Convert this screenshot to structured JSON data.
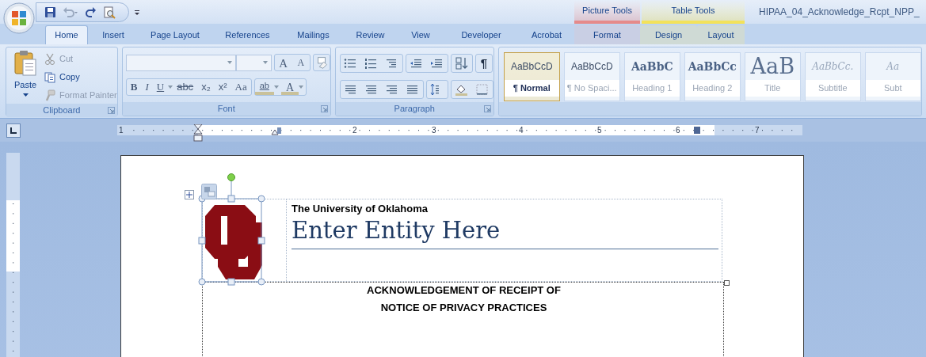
{
  "window": {
    "title": "HIPAA_04_Acknowledge_Rcpt_NPP_"
  },
  "contextual_groups": [
    {
      "label": "Picture Tools",
      "color": "#e58a8a"
    },
    {
      "label": "Table Tools",
      "color": "#f3e25a"
    }
  ],
  "tabs": [
    {
      "label": "Home",
      "selected": true
    },
    {
      "label": "Insert",
      "selected": false
    },
    {
      "label": "Page Layout",
      "selected": false
    },
    {
      "label": "References",
      "selected": false
    },
    {
      "label": "Mailings",
      "selected": false
    },
    {
      "label": "Review",
      "selected": false
    },
    {
      "label": "View",
      "selected": false
    },
    {
      "label": "Developer",
      "selected": false
    },
    {
      "label": "Acrobat",
      "selected": false
    },
    {
      "label": "Format",
      "selected": false
    },
    {
      "label": "Design",
      "selected": false
    },
    {
      "label": "Layout",
      "selected": false
    }
  ],
  "clipboard": {
    "label": "Clipboard",
    "paste": "Paste",
    "commands": [
      {
        "label": "Cut",
        "disabled": true
      },
      {
        "label": "Copy",
        "disabled": false
      },
      {
        "label": "Format Painter",
        "disabled": true
      }
    ]
  },
  "font": {
    "label": "Font",
    "size_buttons": [
      "A",
      "A"
    ],
    "format_buttons": [
      "B",
      "I",
      "U",
      "abc",
      "x₂",
      "x²",
      "Aa"
    ],
    "color_buttons": [
      "ab",
      "A"
    ]
  },
  "paragraph": {
    "label": "Paragraph",
    "show_marks": "¶"
  },
  "styles": [
    {
      "sample": "AaBbCcD",
      "label": "¶ Normal",
      "kind": "body",
      "selected": true
    },
    {
      "sample": "AaBbCcD",
      "label": "¶ No Spaci...",
      "kind": "body",
      "selected": false
    },
    {
      "sample": "AaBbC",
      "label": "Heading 1",
      "kind": "heading",
      "selected": false
    },
    {
      "sample": "AaBbCc",
      "label": "Heading 2",
      "kind": "heading",
      "selected": false
    },
    {
      "sample": "AaB",
      "label": "Title",
      "kind": "title",
      "selected": false
    },
    {
      "sample": "AaBbCc.",
      "label": "Subtitle",
      "kind": "subtitle",
      "selected": false
    },
    {
      "sample": "Aa",
      "label": "Subt",
      "kind": "subtitle",
      "selected": false
    }
  ],
  "ruler": {
    "numbers": [
      "1",
      "2",
      "3",
      "4",
      "5",
      "6",
      "7"
    ]
  },
  "document": {
    "organization": "The University of Oklahoma",
    "entity": "Enter Entity Here",
    "heading": [
      "ACKNOWLEDGEMENT OF RECEIPT OF",
      "NOTICE OF PRIVACY PRACTICES"
    ]
  }
}
